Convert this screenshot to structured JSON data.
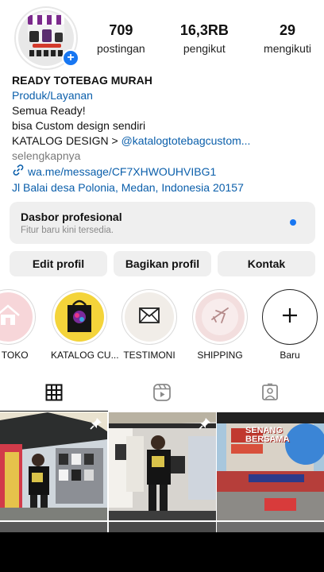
{
  "profile": {
    "stats": [
      {
        "value": "709",
        "label": "postingan"
      },
      {
        "value": "16,3RB",
        "label": "pengikut"
      },
      {
        "value": "29",
        "label": "mengikuti"
      }
    ],
    "add_icon": "plus-icon"
  },
  "bio": {
    "name": "READY TOTEBAG MURAH",
    "category": "Produk/Layanan",
    "line1": "Semua Ready!",
    "line2": "bisa Custom design sendiri",
    "catalog_prefix": "KATALOG DESIGN > ",
    "catalog_link": "@katalogtotebagcustom...",
    "more": "selengkapnya",
    "link": "wa.me/message/CF7XHWOUHVIBG1",
    "location": "Jl Balai desa Polonia, Medan, Indonesia 20157"
  },
  "dashboard": {
    "title": "Dasbor profesional",
    "subtitle": "Fitur baru kini tersedia.",
    "dot_color": "#1877f2"
  },
  "actions": {
    "edit": "Edit profil",
    "share": "Bagikan profil",
    "contact": "Kontak"
  },
  "highlights": [
    {
      "label": "AL TOKO",
      "icon": "house-icon"
    },
    {
      "label": "KATALOG CU...",
      "icon": "tote-bag-image"
    },
    {
      "label": "TESTIMONI",
      "icon": "envelope-icon"
    },
    {
      "label": "SHIPPING",
      "icon": "airplane-icon"
    },
    {
      "label": "Baru",
      "icon": "plus-icon"
    }
  ],
  "tabs": [
    {
      "name": "grid",
      "icon": "grid-icon",
      "active": true
    },
    {
      "name": "reels",
      "icon": "reels-icon",
      "active": false
    },
    {
      "name": "tagged",
      "icon": "tagged-icon",
      "active": false
    }
  ],
  "grid_posts": [
    {
      "overlay_text": ""
    },
    {
      "overlay_text": ""
    },
    {
      "overlay_text": "SENANG BERSAMA"
    }
  ],
  "colors": {
    "link": "#0b5fab",
    "accent": "#1877f2",
    "button_bg": "#efefef"
  }
}
